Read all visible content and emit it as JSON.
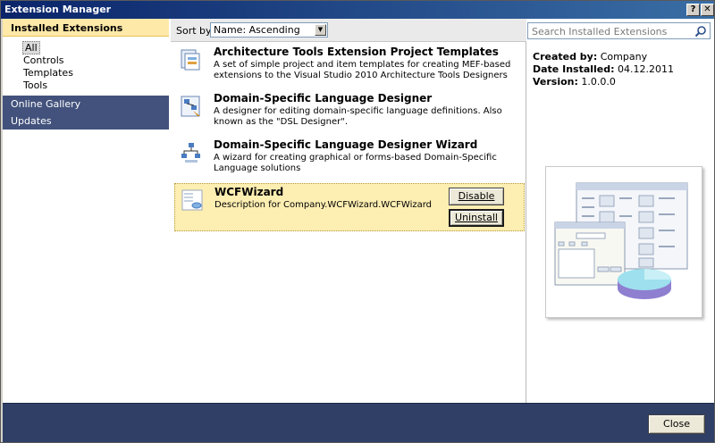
{
  "window": {
    "title": "Extension Manager",
    "help_label": "?",
    "close_label": "✕"
  },
  "nav": {
    "installed_label": "Installed Extensions",
    "installed_items": [
      "All",
      "Controls",
      "Templates",
      "Tools"
    ],
    "online_label": "Online Gallery",
    "updates_label": "Updates"
  },
  "sort": {
    "label": "Sort by:",
    "value": "Name: Ascending"
  },
  "search": {
    "placeholder": "Search Installed Extensions"
  },
  "extensions": [
    {
      "name": "Architecture Tools Extension Project Templates",
      "description": "A set of simple project and item templates for creating MEF-based extensions to the Visual Studio 2010 Architecture Tools Designers"
    },
    {
      "name": "Domain-Specific Language Designer",
      "description": "A designer for editing domain-specific language definitions. Also known as the \"DSL Designer\"."
    },
    {
      "name": "Domain-Specific Language Designer Wizard",
      "description": "A wizard for creating graphical or forms-based Domain-Specific Language solutions"
    },
    {
      "name": "WCFWizard",
      "description": "Description for Company.WCFWizard.WCFWizard"
    }
  ],
  "buttons": {
    "disable": "Disable",
    "uninstall": "Uninstall",
    "close": "Close"
  },
  "details": {
    "created_by_label": "Created by:",
    "created_by": "Company",
    "installed_label": "Date Installed:",
    "installed": "04.12.2011",
    "version_label": "Version:",
    "version": "1.0.0.0"
  }
}
